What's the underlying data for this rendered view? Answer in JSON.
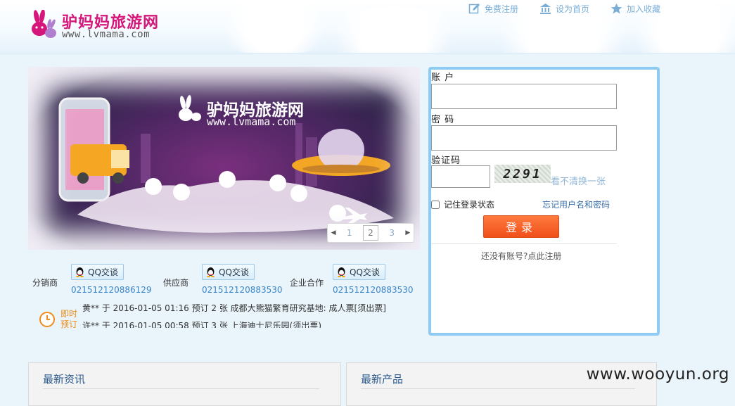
{
  "header": {
    "brand": "驴妈妈旅游网",
    "url": "www.lvmama.com",
    "links": [
      {
        "label": "免费注册",
        "icon": "edit-icon"
      },
      {
        "label": "设为首页",
        "icon": "bank-home-icon"
      },
      {
        "label": "加入收藏",
        "icon": "star-icon"
      }
    ]
  },
  "banner": {
    "brand": "驴妈妈旅游网",
    "url": "www.lvmama.com",
    "pager": {
      "pages": [
        "1",
        "2",
        "3"
      ],
      "active": "2"
    }
  },
  "contacts": [
    {
      "label": "分销商",
      "button": "QQ交谈",
      "phone": "021512120886129"
    },
    {
      "label": "供应商",
      "button": "QQ交谈",
      "phone": "021512120883530"
    },
    {
      "label": "企业合作",
      "button": "QQ交谈",
      "phone": "021512120883530"
    }
  ],
  "instant": {
    "label_line1": "即时",
    "label_line2": "预订",
    "ticker": [
      "黄** 于 2016-01-05 01:16 预订 2 张 成都大熊猫繁育研究基地: 成人票[须出票]",
      "许**  于 2016-01-05 00:58 预订 3 张 上海迪士尼乐园(须出票)"
    ]
  },
  "login": {
    "account_label": "账 户",
    "account_value": "",
    "password_label": "密 码",
    "password_value": "",
    "captcha_label": "验证码",
    "captcha_value": "",
    "captcha_text": "2291",
    "refresh_label": "看不清换一张",
    "remember_label": "记住登录状态",
    "forgot_label": "忘记用户名和密码",
    "submit_label": "登录",
    "register_label": "还没有账号?点此注册"
  },
  "panels": [
    {
      "title": "最新资讯"
    },
    {
      "title": "最新产品"
    }
  ],
  "watermark": "www.wooyun.org",
  "colors": {
    "brand": "#d6167a",
    "link": "#3a86c8",
    "accent": "#f0501a",
    "border": "#8fcaf2"
  }
}
